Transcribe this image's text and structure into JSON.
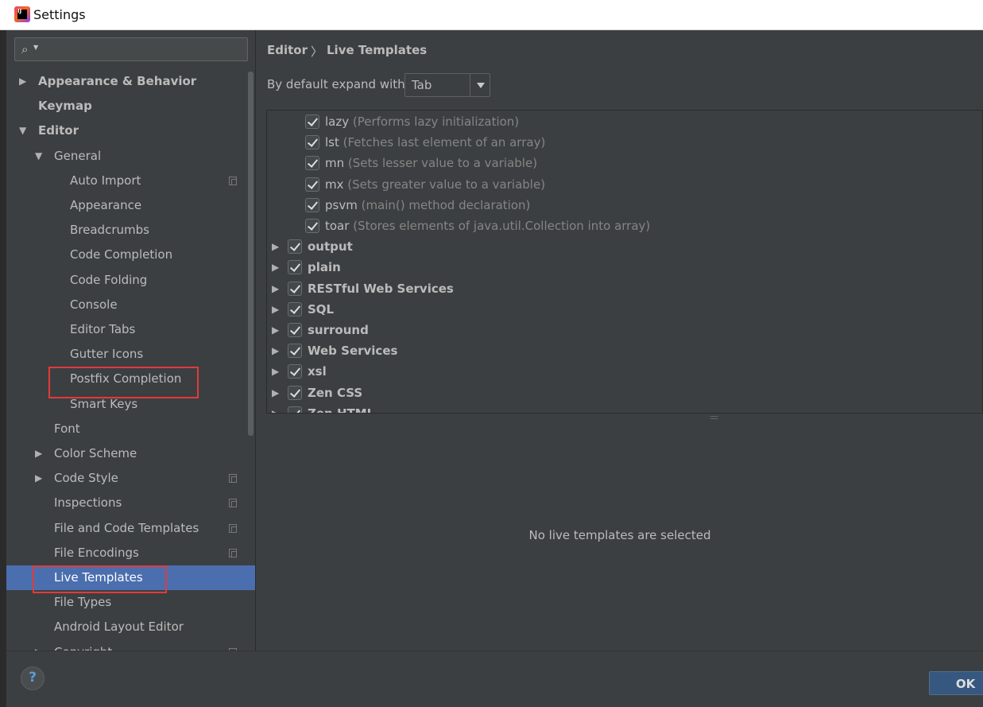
{
  "window": {
    "title": "Settings"
  },
  "search": {
    "placeholder": ""
  },
  "tree": [
    {
      "label": "Appearance & Behavior",
      "bold": true,
      "arrow": "right",
      "indent": 0
    },
    {
      "label": "Keymap",
      "bold": true,
      "arrow": "",
      "indent": 0
    },
    {
      "label": "Editor",
      "bold": true,
      "arrow": "down",
      "indent": 0
    },
    {
      "label": "General",
      "bold": false,
      "arrow": "down",
      "indent": 1
    },
    {
      "label": "Auto Import",
      "bold": false,
      "arrow": "",
      "indent": 2,
      "copy": true
    },
    {
      "label": "Appearance",
      "bold": false,
      "arrow": "",
      "indent": 2
    },
    {
      "label": "Breadcrumbs",
      "bold": false,
      "arrow": "",
      "indent": 2
    },
    {
      "label": "Code Completion",
      "bold": false,
      "arrow": "",
      "indent": 2
    },
    {
      "label": "Code Folding",
      "bold": false,
      "arrow": "",
      "indent": 2
    },
    {
      "label": "Console",
      "bold": false,
      "arrow": "",
      "indent": 2
    },
    {
      "label": "Editor Tabs",
      "bold": false,
      "arrow": "",
      "indent": 2
    },
    {
      "label": "Gutter Icons",
      "bold": false,
      "arrow": "",
      "indent": 2
    },
    {
      "label": "Postfix Completion",
      "bold": false,
      "arrow": "",
      "indent": 2
    },
    {
      "label": "Smart Keys",
      "bold": false,
      "arrow": "",
      "indent": 2
    },
    {
      "label": "Font",
      "bold": false,
      "arrow": "",
      "indent": 1
    },
    {
      "label": "Color Scheme",
      "bold": false,
      "arrow": "right",
      "indent": 1
    },
    {
      "label": "Code Style",
      "bold": false,
      "arrow": "right",
      "indent": 1,
      "copy": true
    },
    {
      "label": "Inspections",
      "bold": false,
      "arrow": "",
      "indent": 1,
      "copy": true
    },
    {
      "label": "File and Code Templates",
      "bold": false,
      "arrow": "",
      "indent": 1,
      "copy": true
    },
    {
      "label": "File Encodings",
      "bold": false,
      "arrow": "",
      "indent": 1,
      "copy": true
    },
    {
      "label": "Live Templates",
      "bold": false,
      "arrow": "",
      "indent": 1,
      "selected": true
    },
    {
      "label": "File Types",
      "bold": false,
      "arrow": "",
      "indent": 1
    },
    {
      "label": "Android Layout Editor",
      "bold": false,
      "arrow": "",
      "indent": 1
    },
    {
      "label": "Copyright",
      "bold": false,
      "arrow": "right",
      "indent": 1,
      "copy": true
    }
  ],
  "breadcrumb": {
    "parent": "Editor",
    "separator": "〉",
    "current": "Live Templates"
  },
  "expand": {
    "label": "By default expand with",
    "value": "Tab"
  },
  "templates": [
    {
      "name": "lazy",
      "desc": "(Performs lazy initialization)",
      "checked": true,
      "group": false
    },
    {
      "name": "lst",
      "desc": "(Fetches last element of an array)",
      "checked": true,
      "group": false
    },
    {
      "name": "mn",
      "desc": "(Sets lesser value to a variable)",
      "checked": true,
      "group": false
    },
    {
      "name": "mx",
      "desc": "(Sets greater value to a variable)",
      "checked": true,
      "group": false
    },
    {
      "name": "psvm",
      "desc": "(main() method declaration)",
      "checked": true,
      "group": false
    },
    {
      "name": "toar",
      "desc": "(Stores elements of java.util.Collection into array)",
      "checked": true,
      "group": false
    },
    {
      "name": "output",
      "desc": "",
      "checked": true,
      "group": true
    },
    {
      "name": "plain",
      "desc": "",
      "checked": true,
      "group": true
    },
    {
      "name": "RESTful Web Services",
      "desc": "",
      "checked": true,
      "group": true
    },
    {
      "name": "SQL",
      "desc": "",
      "checked": true,
      "group": true
    },
    {
      "name": "surround",
      "desc": "",
      "checked": true,
      "group": true
    },
    {
      "name": "Web Services",
      "desc": "",
      "checked": true,
      "group": true
    },
    {
      "name": "xsl",
      "desc": "",
      "checked": true,
      "group": true
    },
    {
      "name": "Zen CSS",
      "desc": "",
      "checked": true,
      "group": true
    },
    {
      "name": "Zen HTML",
      "desc": "",
      "checked": true,
      "group": true
    }
  ],
  "details": {
    "empty_message": "No live templates are selected"
  },
  "footer": {
    "help_label": "?",
    "ok_label": "OK"
  },
  "colors": {
    "selection": "#4b6eaf",
    "highlight_box": "#e03b3b",
    "background": "#3c3f41"
  }
}
